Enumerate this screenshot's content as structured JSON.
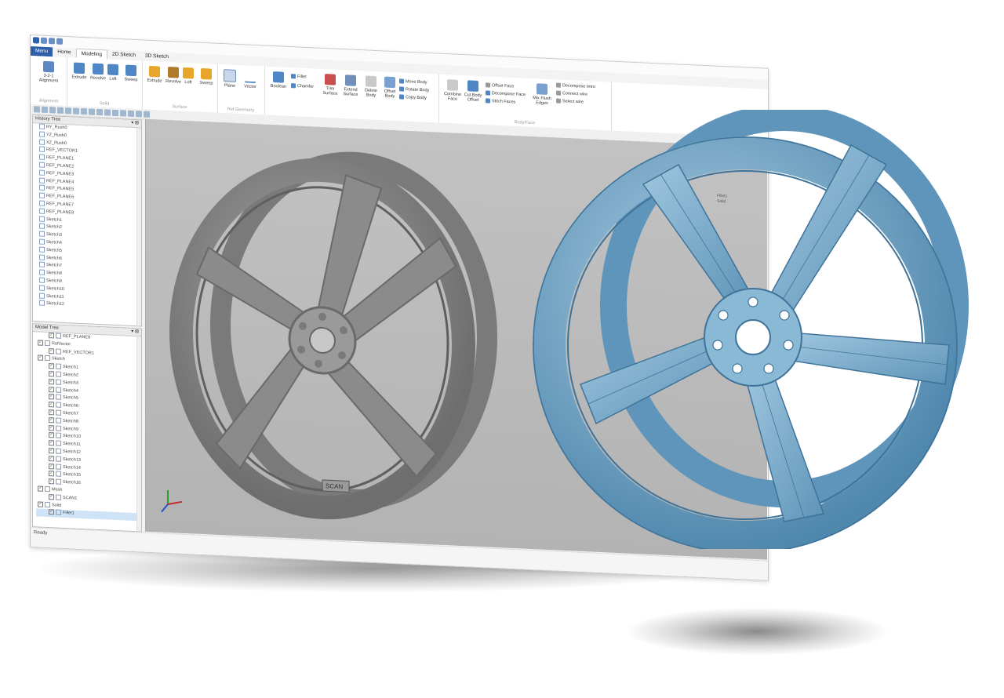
{
  "window": {
    "menu_label": "Menu",
    "tabs": [
      "Home",
      "Modeling",
      "2D Sketch",
      "3D Sketch"
    ],
    "controls": [
      "–",
      "▫",
      "×"
    ]
  },
  "ribbon": {
    "alignment": {
      "button": "3-2-1 Alignment",
      "group": "Alignment"
    },
    "solid": {
      "buttons": [
        "Extrude",
        "Revolve",
        "Loft",
        "Sweep"
      ],
      "group": "Solid"
    },
    "surface": {
      "buttons": [
        "Extrude",
        "Revolve",
        "Loft",
        "Sweep"
      ],
      "group": "Surface"
    },
    "ref_geometry": {
      "buttons": [
        "Plane",
        "Vector"
      ],
      "group": "Ref.Geometry"
    },
    "edit": {
      "buttons": [
        "Boolean",
        "Trim Surface",
        "Extend Surface",
        "Delete Body",
        "Offset Body"
      ],
      "small": [
        "Fillet",
        "Chamfer",
        "Move Body",
        "Rotate Body",
        "Copy Body"
      ]
    },
    "body_faces": {
      "buttons": [
        "Combine Face",
        "Cut Body Offset",
        "Mix Flush Edges"
      ],
      "small": [
        "Offset Face",
        "Decompose Face",
        "Stitch Faces",
        "Decompose Intro",
        "Connect wire",
        "Select wire"
      ],
      "group": "Body/Face"
    }
  },
  "history_tree": {
    "title": "History Tree",
    "items": [
      "RY_Rush0",
      "YZ_Rush0",
      "XZ_Rush0",
      "REF_VECTOR1",
      "REF_PLANE1",
      "REF_PLANE2",
      "REF_PLANE3",
      "REF_PLANE4",
      "REF_PLANE5",
      "REF_PLANE6",
      "REF_PLANE7",
      "REF_PLANE8",
      "Sketch1",
      "Sketch2",
      "Sketch3",
      "Sketch4",
      "Sketch5",
      "Sketch6",
      "Sketch7",
      "Sketch8",
      "Sketch9",
      "Sketch10",
      "Sketch11",
      "Sketch12"
    ]
  },
  "model_tree": {
    "title": "Model Tree",
    "items": [
      "REF_PLANE8",
      "RefVector",
      "REF_VECTOR1",
      "Sketch",
      "Sketch1",
      "Sketch2",
      "Sketch3",
      "Sketch4",
      "Sketch5",
      "Sketch6",
      "Sketch7",
      "Sketch8",
      "Sketch9",
      "Sketch10",
      "Sketch11",
      "Sketch12",
      "Sketch13",
      "Sketch14",
      "Sketch15",
      "Sketch16",
      "Mesh",
      "SCAN1",
      "Solid",
      "Fillet1"
    ]
  },
  "status": {
    "text": "Ready"
  },
  "viewport": {
    "inset_labels": [
      "Fillet1",
      "Solid"
    ],
    "wheel_logo": "SCAN"
  },
  "colors": {
    "accent": "#2e5fa8",
    "blue_wheel": "#7fb0cf",
    "blue_wheel_dark": "#4f87ad",
    "gray_wheel": "#8e8e8e",
    "viewport_bg": "#bdbdbd"
  }
}
